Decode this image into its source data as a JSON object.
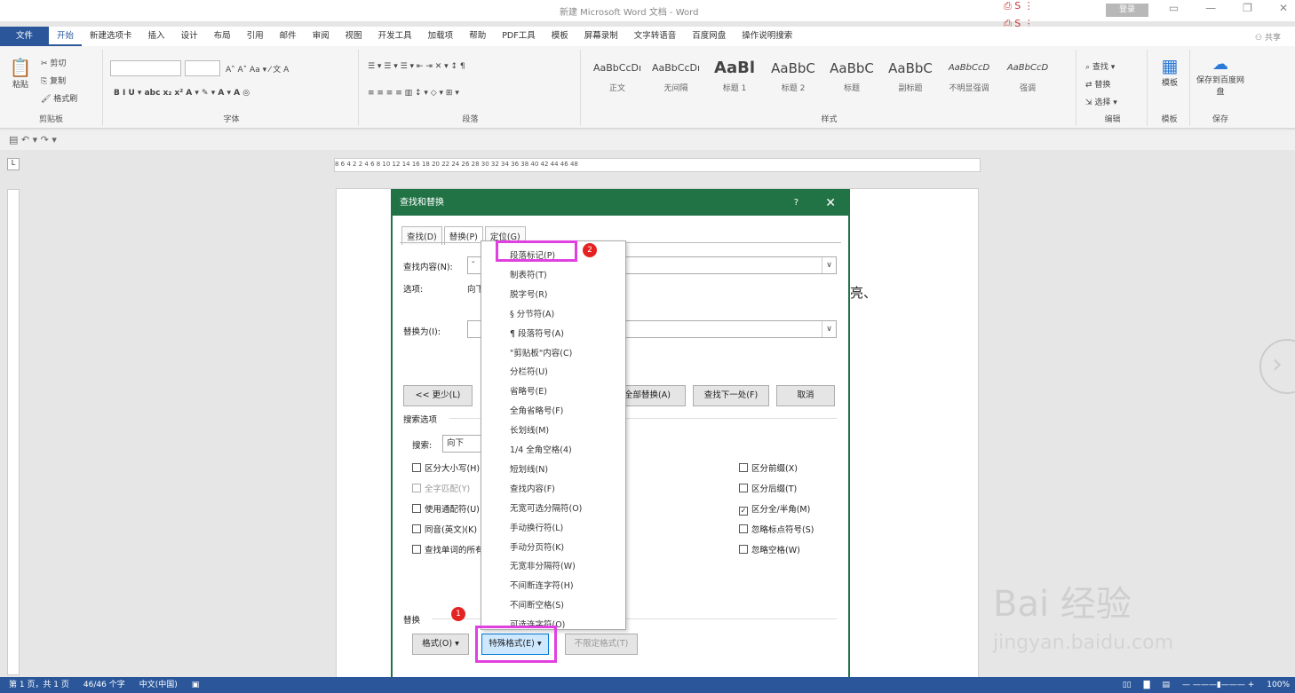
{
  "window": {
    "title": "新建 Microsoft Word 文档 - Word",
    "login": "登录",
    "share": "共享"
  },
  "ribbon_tabs": [
    "文件",
    "开始",
    "新建选项卡",
    "插入",
    "设计",
    "布局",
    "引用",
    "邮件",
    "审阅",
    "视图",
    "开发工具",
    "加载项",
    "帮助",
    "PDF工具",
    "模板",
    "屏幕录制",
    "文字转语音",
    "百度网盘",
    "操作说明搜索"
  ],
  "ribbon": {
    "clipboard": {
      "paste": "粘贴",
      "cut": "剪切",
      "copy": "复制",
      "painter": "格式刷",
      "label": "剪贴板"
    },
    "font": {
      "label": "字体"
    },
    "paragraph": {
      "label": "段落"
    },
    "styles": {
      "label": "样式",
      "items": [
        {
          "sample": "AaBbCcDı",
          "name": "正文"
        },
        {
          "sample": "AaBbCcDı",
          "name": "无间隔"
        },
        {
          "sample": "AaBl",
          "name": "标题 1"
        },
        {
          "sample": "AaBbC",
          "name": "标题 2"
        },
        {
          "sample": "AaBbC",
          "name": "标题"
        },
        {
          "sample": "AaBbC",
          "name": "副标题"
        },
        {
          "sample": "AaBbCcD",
          "name": "不明显强调"
        },
        {
          "sample": "AaBbCcD",
          "name": "强调"
        }
      ]
    },
    "editing": {
      "find": "查找",
      "replace": "替换",
      "select": "选择",
      "label": "编辑"
    },
    "template": {
      "btn": "模板",
      "label": "模板"
    },
    "save": {
      "btn": "保存到百度网盘",
      "label": "保存"
    }
  },
  "ruler_numbers": "8   6   4   2       2   4   6   8   10   12   14   16   18   20   22   24   26   28   30   32   34   36   38   40   42   44   46   48",
  "document": {
    "visible_text": "亮、"
  },
  "dialog": {
    "title": "查找和替换",
    "help": "?",
    "close": "✕",
    "tabs": [
      "查找(D)",
      "替换(P)",
      "定位(G)"
    ],
    "find_label": "查找内容(N):",
    "find_value": "-",
    "options_label": "选项:",
    "options_value": "向下",
    "replace_label": "替换为(I):",
    "less_btn": "<< 更少(L)",
    "replace_all_btn": "全部替换(A)",
    "find_next_btn": "查找下一处(F)",
    "cancel_btn": "取消",
    "search_options_label": "搜索选项",
    "search_label": "搜索:",
    "search_value": "向下",
    "checkboxes_left": [
      {
        "label": "区分大小写(H)",
        "checked": false,
        "enabled": true
      },
      {
        "label": "全字匹配(Y)",
        "checked": false,
        "enabled": false
      },
      {
        "label": "使用通配符(U)",
        "checked": false,
        "enabled": true
      },
      {
        "label": "同音(英文)(K)",
        "checked": false,
        "enabled": true
      },
      {
        "label": "查找单词的所有形式(英文)(W)",
        "checked": false,
        "enabled": true
      }
    ],
    "checkboxes_right": [
      {
        "label": "区分前缀(X)",
        "checked": false
      },
      {
        "label": "区分后缀(T)",
        "checked": false
      },
      {
        "label": "区分全/半角(M)",
        "checked": true
      },
      {
        "label": "忽略标点符号(S)",
        "checked": false
      },
      {
        "label": "忽略空格(W)",
        "checked": false
      }
    ],
    "replace_section": "替换",
    "format_btn": "格式(O) ▾",
    "special_btn": "特殊格式(E) ▾",
    "no_format_btn": "不限定格式(T)"
  },
  "special_menu": [
    "段落标记(P)",
    "制表符(T)",
    "脱字号(R)",
    "§ 分节符(A)",
    "¶ 段落符号(A)",
    "\"剪贴板\"内容(C)",
    "分栏符(U)",
    "省略号(E)",
    "全角省略号(F)",
    "长划线(M)",
    "1/4 全角空格(4)",
    "短划线(N)",
    "查找内容(F)",
    "无宽可选分隔符(O)",
    "手动换行符(L)",
    "手动分页符(K)",
    "无宽非分隔符(W)",
    "不间断连字符(H)",
    "不间断空格(S)",
    "可选连字符(O)"
  ],
  "badges": [
    "1",
    "2"
  ],
  "status": {
    "page": "第 1 页，共 1 页",
    "words": "46/46 个字",
    "lang": "中文(中国)",
    "zoom": "100%"
  },
  "watermark": {
    "brand": "Bai 经验",
    "url": "jingyan.baidu.com"
  }
}
